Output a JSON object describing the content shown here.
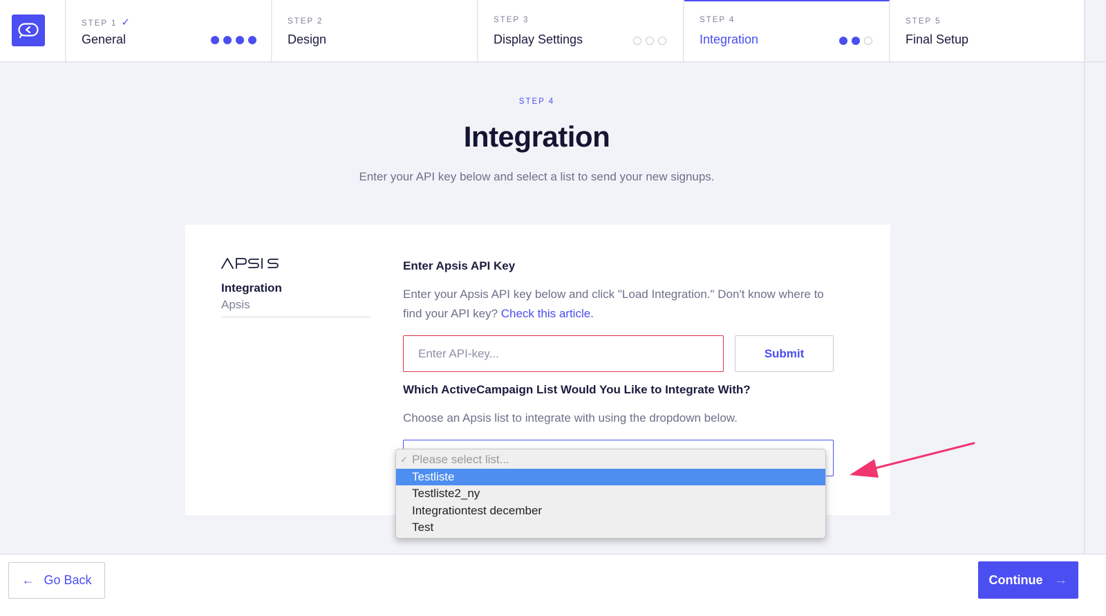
{
  "steps": [
    {
      "num": "STEP 1",
      "check": "✓",
      "title": "General"
    },
    {
      "num": "STEP 2",
      "title": "Design"
    },
    {
      "num": "STEP 3",
      "title": "Display Settings"
    },
    {
      "num": "STEP 4",
      "title": "Integration"
    },
    {
      "num": "STEP 5",
      "title": "Final Setup"
    }
  ],
  "heading": {
    "eyebrow": "STEP 4",
    "title": "Integration",
    "subtitle": "Enter your API key below and select a list to send your new signups."
  },
  "card": {
    "brand": "APSIS",
    "integration_label": "Integration",
    "integration_name": "Apsis",
    "api_section": {
      "title": "Enter Apsis API Key",
      "desc_text": "Enter your Apsis API key below and click \"Load Integration.\" Don't know where to find your API key? ",
      "link_text": "Check this article.",
      "input_placeholder": "Enter API-key...",
      "submit_label": "Submit"
    },
    "list_section": {
      "title": "Which ActiveCampaign List Would You Like to Integrate With?",
      "desc": "Choose an Apsis list to integrate with using the dropdown below."
    }
  },
  "dropdown": {
    "placeholder": "Please select list...",
    "placeholder_check": "✓",
    "options": [
      "Testliste",
      "Testliste2_ny",
      "Integrationtest december",
      "Test"
    ],
    "highlighted": "Testliste"
  },
  "footer": {
    "back_label": "Go Back",
    "back_arrow": "←",
    "continue_label": "Continue",
    "continue_arrow": "→"
  },
  "colors": {
    "accent": "#4b4ef0",
    "error_border": "#e0344b",
    "annotation_arrow": "#f0356f",
    "dropdown_highlight": "#4e8ef0"
  }
}
